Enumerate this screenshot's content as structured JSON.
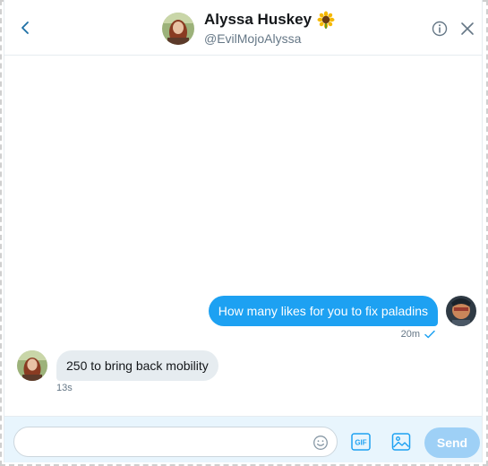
{
  "colors": {
    "accent": "#1da1f2",
    "send_disabled": "#9ed0f6",
    "incoming_bubble": "#e6ecf0",
    "secondary_text": "#657786",
    "composer_bg": "#e8f5fd"
  },
  "header": {
    "back_icon": "chevron-left-icon",
    "display_name": "Alyssa Huskey",
    "name_emoji": "sunflower-icon",
    "handle": "@EvilMojoAlyssa",
    "info_icon": "info-icon",
    "close_icon": "close-icon"
  },
  "conversation": {
    "messages": [
      {
        "direction": "outgoing",
        "text": "How many likes for you to fix paladins",
        "time": "20m",
        "status_icon": "checkmark-icon"
      },
      {
        "direction": "incoming",
        "text": "250 to bring back mobility",
        "time": "13s"
      }
    ]
  },
  "composer": {
    "input_value": "",
    "input_placeholder": "",
    "emoji_icon": "smiley-icon",
    "gif_icon": "gif-icon",
    "image_icon": "image-icon",
    "send_label": "Send"
  }
}
